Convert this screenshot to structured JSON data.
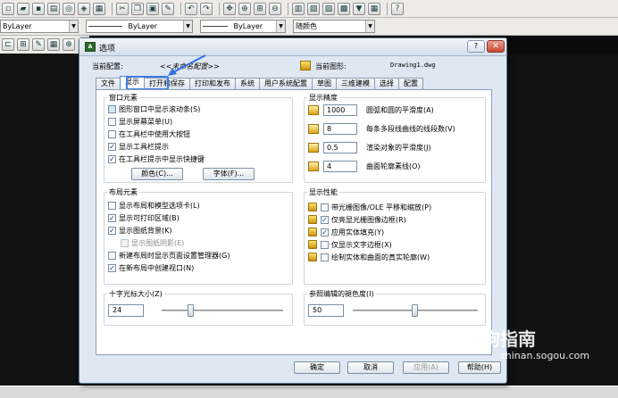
{
  "app": {
    "toolbar_icons": [
      "new-icon",
      "open-icon",
      "save-icon",
      "print-icon",
      "preview-icon",
      "publish-icon",
      "plot-icon",
      "cut-icon",
      "copy-icon",
      "paste-icon",
      "match-icon",
      "undo-icon",
      "redo-icon",
      "pan-icon",
      "zoom-realtime-icon",
      "zoom-window-icon",
      "zoom-previous-icon",
      "properties-icon",
      "design-center-icon",
      "tool-palette-icon",
      "sheet-set-icon",
      "markup-icon",
      "calc-icon",
      "help-icon"
    ],
    "layer_color": "ByLayer",
    "layer_linetype": "ByLayer",
    "layer_lineweight": "ByLayer",
    "plot_style": "随颜色"
  },
  "dialog": {
    "title": "选项",
    "help_label": "?",
    "close_label": "✕",
    "current_profile_label": "当前配置:",
    "current_profile_value": "<<未命名配置>>",
    "current_drawing_label": "当前图形:",
    "current_drawing_value": "Drawing1.dwg",
    "tabs": [
      "文件",
      "显示",
      "打开和保存",
      "打印和发布",
      "系统",
      "用户系统配置",
      "草图",
      "三维建模",
      "选择",
      "配置"
    ],
    "active_tab": "显示",
    "window_elements": {
      "title": "窗口元素",
      "items": [
        {
          "label": "图形窗口中显示滚动条(S)",
          "checked": false
        },
        {
          "label": "显示屏幕菜单(U)",
          "checked": false
        },
        {
          "label": "在工具栏中使用大按钮",
          "checked": false
        },
        {
          "label": "显示工具栏提示",
          "checked": true
        },
        {
          "label": "在工具栏提示中显示快捷键",
          "checked": true
        }
      ],
      "colors_button": "颜色(C)...",
      "fonts_button": "字体(F)..."
    },
    "layout_elements": {
      "title": "布局元素",
      "items": [
        {
          "label": "显示布局和模型选项卡(L)",
          "checked": false,
          "disabled": false
        },
        {
          "label": "显示可打印区域(B)",
          "checked": true,
          "disabled": false
        },
        {
          "label": "显示图纸背景(K)",
          "checked": true,
          "disabled": false
        },
        {
          "label": "显示图纸阴影(E)",
          "checked": false,
          "disabled": true
        },
        {
          "label": "新建布局时显示页面设置管理器(G)",
          "checked": false,
          "disabled": false
        },
        {
          "label": "在新布局中创建视口(N)",
          "checked": true,
          "disabled": false
        }
      ]
    },
    "crosshair": {
      "title": "十字光标大小(Z)",
      "value": "24",
      "slider_fraction": 0.24
    },
    "display_resolution": {
      "title": "显示精度",
      "items": [
        {
          "value": "1000",
          "label": "圆弧和圆的平滑度(A)"
        },
        {
          "value": "8",
          "label": "每条多段线曲线的线段数(V)"
        },
        {
          "value": "0.5",
          "label": "渲染对象的平滑度(J)"
        },
        {
          "value": "4",
          "label": "曲面轮廓素线(O)"
        }
      ]
    },
    "display_performance": {
      "title": "显示性能",
      "items": [
        {
          "label": "带光栅图像/OLE 平移和缩放(P)",
          "checked": false
        },
        {
          "label": "仅亮显光栅图像边框(R)",
          "checked": true
        },
        {
          "label": "应用实体填充(Y)",
          "checked": true
        },
        {
          "label": "仅显示文字边框(X)",
          "checked": false
        },
        {
          "label": "绘制实体和曲面的真实轮廓(W)",
          "checked": false
        }
      ]
    },
    "xref_fade": {
      "title": "参照编辑的褪色度(I)",
      "value": "50",
      "slider_fraction": 0.5
    },
    "buttons": {
      "ok": "确定",
      "cancel": "取消",
      "apply": "应用(A)",
      "help": "帮助(H)"
    }
  },
  "watermark": {
    "text": "搜狗指南",
    "url": "zhinan.sogou.com"
  }
}
